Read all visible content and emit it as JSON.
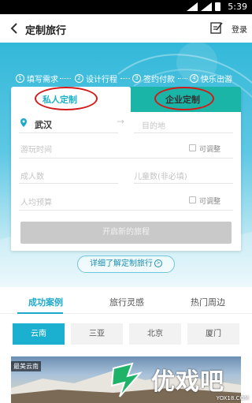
{
  "status_bar": {
    "time": "5:39"
  },
  "header": {
    "title": "定制旅行",
    "login_label": "登录"
  },
  "steps": [
    {
      "num": "1",
      "label": "填写需求"
    },
    {
      "num": "2",
      "label": "设计行程"
    },
    {
      "num": "3",
      "label": "签约付款"
    },
    {
      "num": "4",
      "label": "快乐出游"
    }
  ],
  "tabs": {
    "private_label": "私人定制",
    "corporate_label": "企业定制"
  },
  "form": {
    "origin_value": "武汉",
    "destination_placeholder": "目的地",
    "travel_time_placeholder": "游玩时间",
    "adjustable_label_1": "可调整",
    "adults_placeholder": "成人数",
    "children_placeholder": "儿童数(非必填)",
    "budget_placeholder": "人均预算",
    "adjustable_label_2": "可调整",
    "submit_label": "开启新的旅程"
  },
  "detail_link_label": "详细了解定制旅行",
  "sections": {
    "tabs": [
      "成功案例",
      "旅行灵感",
      "热门周边"
    ],
    "active_index": 0
  },
  "destinations": {
    "items": [
      "云南",
      "三亚",
      "北京",
      "厦门"
    ],
    "active_index": 0
  },
  "case_card": {
    "badge": "最美云南"
  },
  "watermark": {
    "text": "优戏吧",
    "url": "YOX18.COM"
  },
  "colors": {
    "accent": "#1ca9c9",
    "corporate_tab": "#1bb5a7",
    "annotation": "#d21a1a"
  }
}
